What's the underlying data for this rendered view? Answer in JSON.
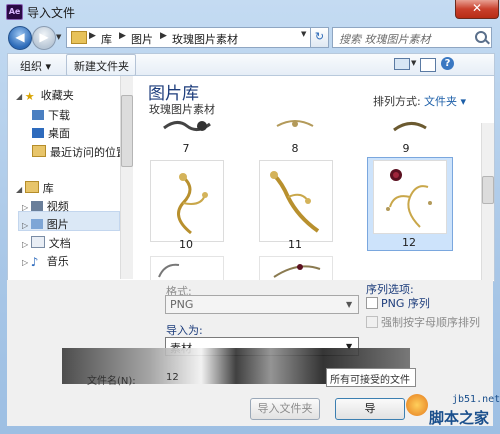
{
  "window": {
    "title": "导入文件",
    "app_icon_text": "Ae",
    "close_glyph": "✕"
  },
  "nav": {
    "back_glyph": "◀",
    "fwd_glyph": "▶",
    "breadcrumb": [
      "库",
      "图片",
      "玫瑰图片素材"
    ],
    "refresh_glyph": "↻",
    "search_placeholder": "搜索 玫瑰图片素材"
  },
  "toolbar": {
    "organize_label": "组织 ▾",
    "new_folder_label": "新建文件夹",
    "help_glyph": "?"
  },
  "sidebar": {
    "favorites_label": "收藏夹",
    "favorites": [
      "下载",
      "桌面",
      "最近访问的位置"
    ],
    "libraries_label": "库",
    "libraries": [
      "视频",
      "图片",
      "文档",
      "音乐"
    ]
  },
  "library": {
    "title": "图片库",
    "subtitle": "玫瑰图片素材",
    "sort_label": "排列方式:",
    "sort_value": "文件夹 ▾"
  },
  "files": {
    "row1_labels": [
      "7",
      "8",
      "9"
    ],
    "row2_labels": [
      "10",
      "11",
      "12"
    ],
    "selected": "12"
  },
  "options": {
    "format_label": "格式:",
    "format_value": "PNG",
    "sequence_options_label": "序列选项:",
    "png_sequence_label": "PNG 序列",
    "force_alpha_label": "强制按字母顺序排列",
    "import_as_label": "导入为:",
    "import_as_value": "素材",
    "filename_label": "文件名(N):",
    "filename_value": "12",
    "filetype_value": "所有可接受的文件",
    "import_folder_button": "导入文件夹",
    "import_button": "导"
  },
  "watermark": {
    "domain": "jb51.net",
    "name": "脚本之家"
  }
}
